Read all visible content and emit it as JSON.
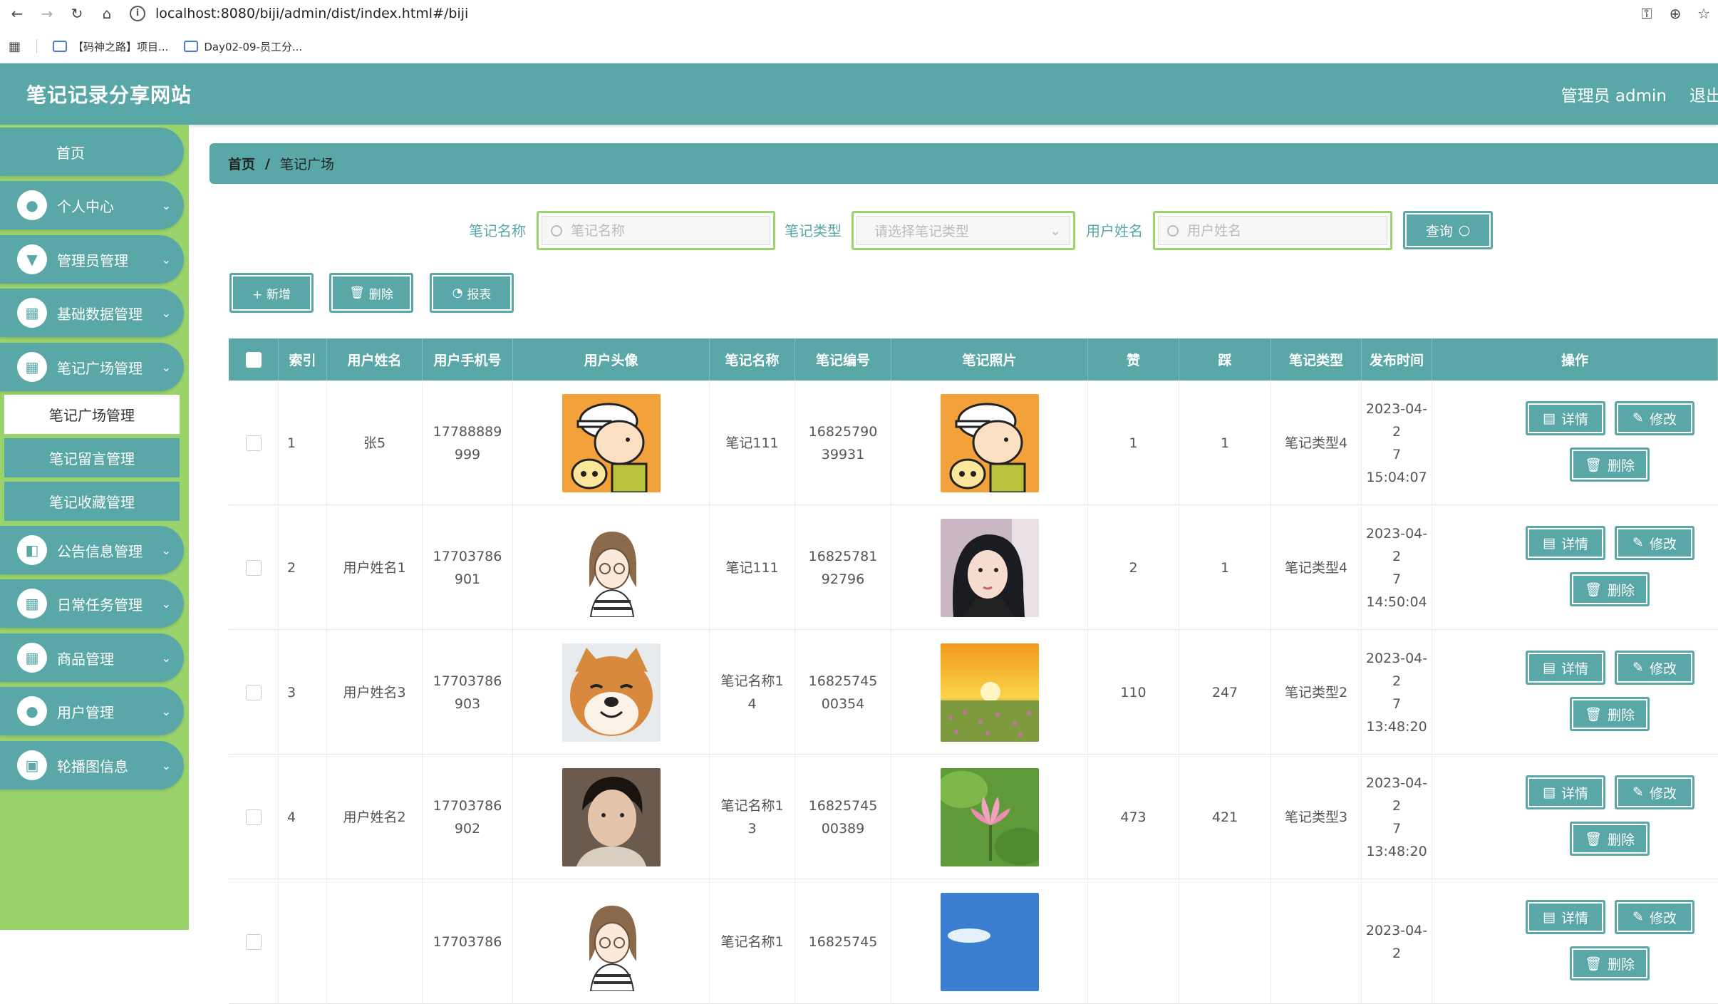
{
  "browser": {
    "url": "localhost:8080/biji/admin/dist/index.html#/biji",
    "bookmarks": [
      "【码神之路】项目...",
      "Day02-09-员工分..."
    ]
  },
  "header": {
    "title": "笔记记录分享网站",
    "user": "管理员 admin",
    "logout": "退出"
  },
  "sidebar": {
    "home": "首页",
    "items": [
      {
        "label": "个人中心",
        "icon": "user-icon"
      },
      {
        "label": "管理员管理",
        "icon": "admin-icon"
      },
      {
        "label": "基础数据管理",
        "icon": "grid-icon"
      },
      {
        "label": "笔记广场管理",
        "icon": "grid-icon"
      }
    ],
    "submenu": [
      "笔记广场管理",
      "笔记留言管理",
      "笔记收藏管理"
    ],
    "items_after": [
      {
        "label": "公告信息管理",
        "icon": "notice-icon"
      },
      {
        "label": "日常任务管理",
        "icon": "grid-icon"
      },
      {
        "label": "商品管理",
        "icon": "grid-icon"
      },
      {
        "label": "用户管理",
        "icon": "user-icon"
      },
      {
        "label": "轮播图信息",
        "icon": "image-icon"
      }
    ]
  },
  "breadcrumb": {
    "home": "首页",
    "separator": "/",
    "current": "笔记广场"
  },
  "search": {
    "name_label": "笔记名称",
    "name_placeholder": "笔记名称",
    "type_label": "笔记类型",
    "type_placeholder": "请选择笔记类型",
    "user_label": "用户姓名",
    "user_placeholder": "用户姓名",
    "query": "查询"
  },
  "toolbar": {
    "add": "+ 新增",
    "delete": "删除",
    "report": "报表"
  },
  "table": {
    "headers": [
      "索引",
      "用户姓名",
      "用户手机号",
      "用户头像",
      "笔记名称",
      "笔记编号",
      "笔记照片",
      "赞",
      "踩",
      "笔记类型",
      "发布时间",
      "操作"
    ],
    "rows": [
      {
        "index": "1",
        "user": "张5",
        "phone": "17788889\n999",
        "name": "笔记111",
        "no": "16825790\n39931",
        "like": "1",
        "dislike": "1",
        "type": "笔记类型4",
        "time": "2023-04-2\n7 15:04:07",
        "avatar": "cartoon",
        "photo": "cartoon"
      },
      {
        "index": "2",
        "user": "用户姓名1",
        "phone": "17703786\n901",
        "name": "笔记111",
        "no": "16825781\n92796",
        "like": "2",
        "dislike": "1",
        "type": "笔记类型4",
        "time": "2023-04-2\n7 14:50:04",
        "avatar": "sketch",
        "photo": "portrait"
      },
      {
        "index": "3",
        "user": "用户姓名3",
        "phone": "17703786\n903",
        "name": "笔记名称1\n4",
        "no": "16825745\n00354",
        "like": "110",
        "dislike": "247",
        "type": "笔记类型2",
        "time": "2023-04-2\n7 13:48:20",
        "avatar": "dog",
        "photo": "sunset"
      },
      {
        "index": "4",
        "user": "用户姓名2",
        "phone": "17703786\n902",
        "name": "笔记名称1\n3",
        "no": "16825745\n00389",
        "like": "473",
        "dislike": "421",
        "type": "笔记类型3",
        "time": "2023-04-2\n7 13:48:20",
        "avatar": "man",
        "photo": "lotus"
      },
      {
        "index": "",
        "user": "",
        "phone": "17703786",
        "name": "笔记名称1",
        "no": "16825745",
        "like": "",
        "dislike": "",
        "type": "",
        "time": "2023-04-2",
        "avatar": "sketch",
        "photo": "sky"
      }
    ],
    "actions": {
      "detail": "详情",
      "edit": "修改",
      "delete": "删除"
    }
  },
  "colors": {
    "teal": "#5aa7a7",
    "green": "#9ad26b"
  }
}
